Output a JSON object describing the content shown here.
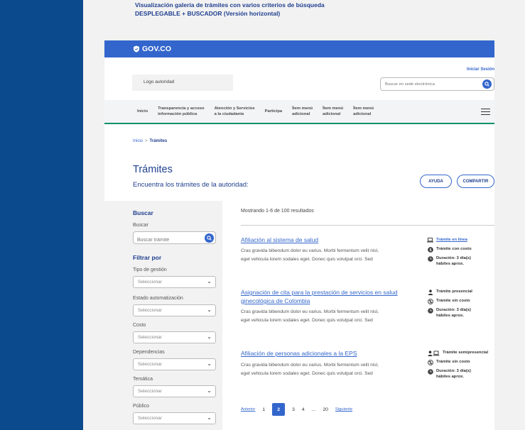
{
  "doc_note": {
    "line1": "Visualización galería de trámites con varios criterios de búsqueda",
    "line2": "DESPLEGABLE + BUSCADOR (Versión horizontal)"
  },
  "govbar": {
    "logo_text": "GOV.CO"
  },
  "header": {
    "logo_placeholder": "Logo autoridad",
    "login_label": "Iniciar Sesión",
    "search_placeholder": "Buscar en sede electrónica"
  },
  "nav": {
    "items": [
      {
        "line1": "Inicio",
        "line2": ""
      },
      {
        "line1": "Transparencia y acceso",
        "line2": "información pública"
      },
      {
        "line1": "Atención y Servicios",
        "line2": "a la ciudadanía"
      },
      {
        "line1": "Participa",
        "line2": ""
      },
      {
        "line1": "Ítem menú",
        "line2": "adicional"
      },
      {
        "line1": "Ítem menú",
        "line2": "adicional"
      },
      {
        "line1": "Ítem menú",
        "line2": "adicional"
      }
    ]
  },
  "breadcrumb": {
    "home": "Inicio",
    "separator": ">",
    "current": "Trámites"
  },
  "page": {
    "title": "Trámites",
    "subtitle": "Encuentra los trámites de la autoridad:",
    "help_label": "AYUDA",
    "share_label": "COMPARTIR"
  },
  "sidebar": {
    "search_heading": "Buscar",
    "search_label": "Buscar",
    "search_placeholder": "Buscar trámite",
    "filter_heading": "Filtrar por",
    "filters": [
      {
        "label": "Tipo de gestión",
        "value": "Seleccionar"
      },
      {
        "label": "Estado automatización",
        "value": "Seleccionar"
      },
      {
        "label": "Costo",
        "value": "Seleccionar"
      },
      {
        "label": "Dependencias",
        "value": "Seleccionar"
      },
      {
        "label": "Temática",
        "value": "Seleccionar"
      },
      {
        "label": "Público",
        "value": "Seleccionar"
      }
    ]
  },
  "results": {
    "count_text": "Mostrando 1-6 de 100 resultados",
    "items": [
      {
        "title_l1": "Afiliación al sistema de salud",
        "title_l2": "",
        "desc_l1": "Cras gravida bibendum dolor eu varius. Morbi fermentum velit nisl,",
        "desc_l2": "eget vehicula lorem sodales eget. Donec quis volutpat orci. Sed",
        "modality": "Trámite en línea",
        "cost": "Trámite con costo",
        "duration_l1": "Duración: 3 día(s)",
        "duration_l2": "hábiles aprox."
      },
      {
        "title_l1": "Asignación de cita para la prestación de servicios en salud",
        "title_l2": "ginecológica de Colombia",
        "desc_l1": "Cras gravida bibendum dolor eu varius. Morbi fermentum velit nisl,",
        "desc_l2": "eget vehicula lorem sodales eget. Donec quis volutpat orci. Sed",
        "modality": "Trámite presencial",
        "cost": "Trámite sin costo",
        "duration_l1": "Duración: 3 día(s)",
        "duration_l2": "hábiles aprox."
      },
      {
        "title_l1": "Afiliación de personas adicionales a la EPS",
        "title_l2": "",
        "desc_l1": "Cras gravida bibendum dolor eu varius. Morbi fermentum velit nisl,",
        "desc_l2": "eget vehicula lorem sodales eget. Donec quis volutpat orci. Sed",
        "modality": "Trámite semipresencial",
        "cost": "Trámite sin costo",
        "duration_l1": "Duración: 3 día(s)",
        "duration_l2": "hábiles aprox."
      }
    ]
  },
  "pagination": {
    "prev": "Anterior",
    "pages": [
      "1",
      "2",
      "3",
      "4",
      "...",
      "20"
    ],
    "current": "2",
    "next": "Siguiente"
  },
  "colors": {
    "primary": "#3366cc",
    "dark_blue": "#1f3f8f",
    "rail": "#0b4a8c",
    "nav_accent": "#069169"
  }
}
